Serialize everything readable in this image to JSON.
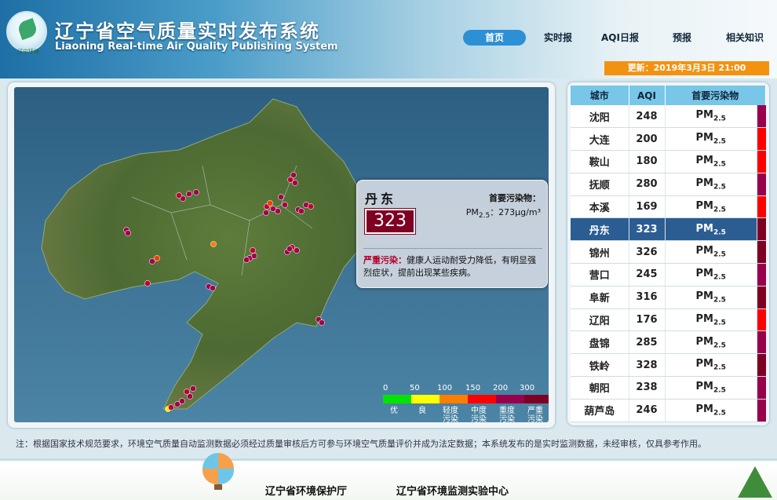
{
  "header": {
    "title_cn": "辽宁省空气质量实时发布系统",
    "title_en": "Liaoning Real-time Air Quality Publishing System",
    "logo_text": "辽宁环境"
  },
  "nav": [
    "首页",
    "实时报",
    "AQI日报",
    "预报",
    "相关知识"
  ],
  "nav_active": "首页",
  "update_text": "更新：2019年3月3日  21:00",
  "popup": {
    "city": "丹东",
    "aqi": "323",
    "pollutant_label": "首要污染物：",
    "pollutant_value": "PM2.5：273μg/m³",
    "level": "严重污染：",
    "advice": "健康人运动耐受力降低，有明显强烈症状，提前出现某些疾病。"
  },
  "legend": {
    "ticks": [
      "0",
      "50",
      "100",
      "150",
      "200",
      "300"
    ],
    "labels": [
      "优",
      "良",
      "轻度污染",
      "中度污染",
      "重度污染",
      "严重污染"
    ],
    "colors": [
      "#00e400",
      "#ffff00",
      "#ff7e00",
      "#ff0000",
      "#99004c",
      "#7e0023"
    ]
  },
  "table": {
    "headers": [
      "城市",
      "AQI",
      "首要污染物"
    ],
    "selected_city": "丹东",
    "rows": [
      {
        "city": "沈阳",
        "aqi": "248",
        "pollutant": "PM2.5",
        "color": "#99004c"
      },
      {
        "city": "大连",
        "aqi": "200",
        "pollutant": "PM2.5",
        "color": "#ff0000"
      },
      {
        "city": "鞍山",
        "aqi": "180",
        "pollutant": "PM2.5",
        "color": "#ff0000"
      },
      {
        "city": "抚顺",
        "aqi": "280",
        "pollutant": "PM2.5",
        "color": "#99004c"
      },
      {
        "city": "本溪",
        "aqi": "169",
        "pollutant": "PM2.5",
        "color": "#ff0000"
      },
      {
        "city": "丹东",
        "aqi": "323",
        "pollutant": "PM2.5",
        "color": "#7e0023"
      },
      {
        "city": "锦州",
        "aqi": "326",
        "pollutant": "PM2.5",
        "color": "#7e0023"
      },
      {
        "city": "营口",
        "aqi": "245",
        "pollutant": "PM2.5",
        "color": "#99004c"
      },
      {
        "city": "阜新",
        "aqi": "316",
        "pollutant": "PM2.5",
        "color": "#7e0023"
      },
      {
        "city": "辽阳",
        "aqi": "176",
        "pollutant": "PM2.5",
        "color": "#ff0000"
      },
      {
        "city": "盘锦",
        "aqi": "285",
        "pollutant": "PM2.5",
        "color": "#99004c"
      },
      {
        "city": "铁岭",
        "aqi": "328",
        "pollutant": "PM2.5",
        "color": "#7e0023"
      },
      {
        "city": "朝阳",
        "aqi": "238",
        "pollutant": "PM2.5",
        "color": "#99004c"
      },
      {
        "city": "葫芦岛",
        "aqi": "246",
        "pollutant": "PM2.5",
        "color": "#99004c"
      }
    ]
  },
  "note": "注：根据国家技术规范要求，环境空气质量自动监测数据必须经过质量审核后方可参与环境空气质量评价并成为法定数据；本系统发布的是实时监测数据，未经审核，仅具参考作用。",
  "footer": {
    "link1": "辽宁省环境保护厅",
    "link2": "辽宁省环境监测实验中心"
  }
}
